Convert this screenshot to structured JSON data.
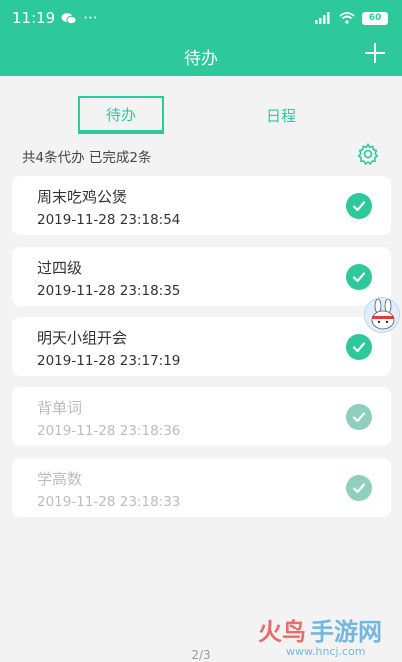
{
  "status_bar": {
    "time": "11:19",
    "dots": "···",
    "signal": "HD",
    "battery": "60"
  },
  "header": {
    "title": "待办",
    "add_icon": "plus-icon"
  },
  "tabs": [
    {
      "label": "待办",
      "active": true
    },
    {
      "label": "日程",
      "active": false
    }
  ],
  "summary": {
    "text": "共4条代办 已完成2条",
    "settings_icon": "gear-icon"
  },
  "todos": [
    {
      "title": "周末吃鸡公煲",
      "time": "2019-11-28 23:18:54",
      "done": false
    },
    {
      "title": "过四级",
      "time": "2019-11-28 23:18:35",
      "done": false
    },
    {
      "title": "明天小组开会",
      "time": "2019-11-28 23:17:19",
      "done": false
    },
    {
      "title": "背单词",
      "time": "2019-11-28 23:18:36",
      "done": true
    },
    {
      "title": "学高数",
      "time": "2019-11-28 23:18:33",
      "done": true
    }
  ],
  "pagination": "2/3",
  "watermark": {
    "text": "火鸟手游网",
    "url": "www.hncj.com"
  },
  "colors": {
    "accent": "#2ec99a",
    "done_check": "#8fcfbd",
    "background": "#f3f3f3"
  }
}
